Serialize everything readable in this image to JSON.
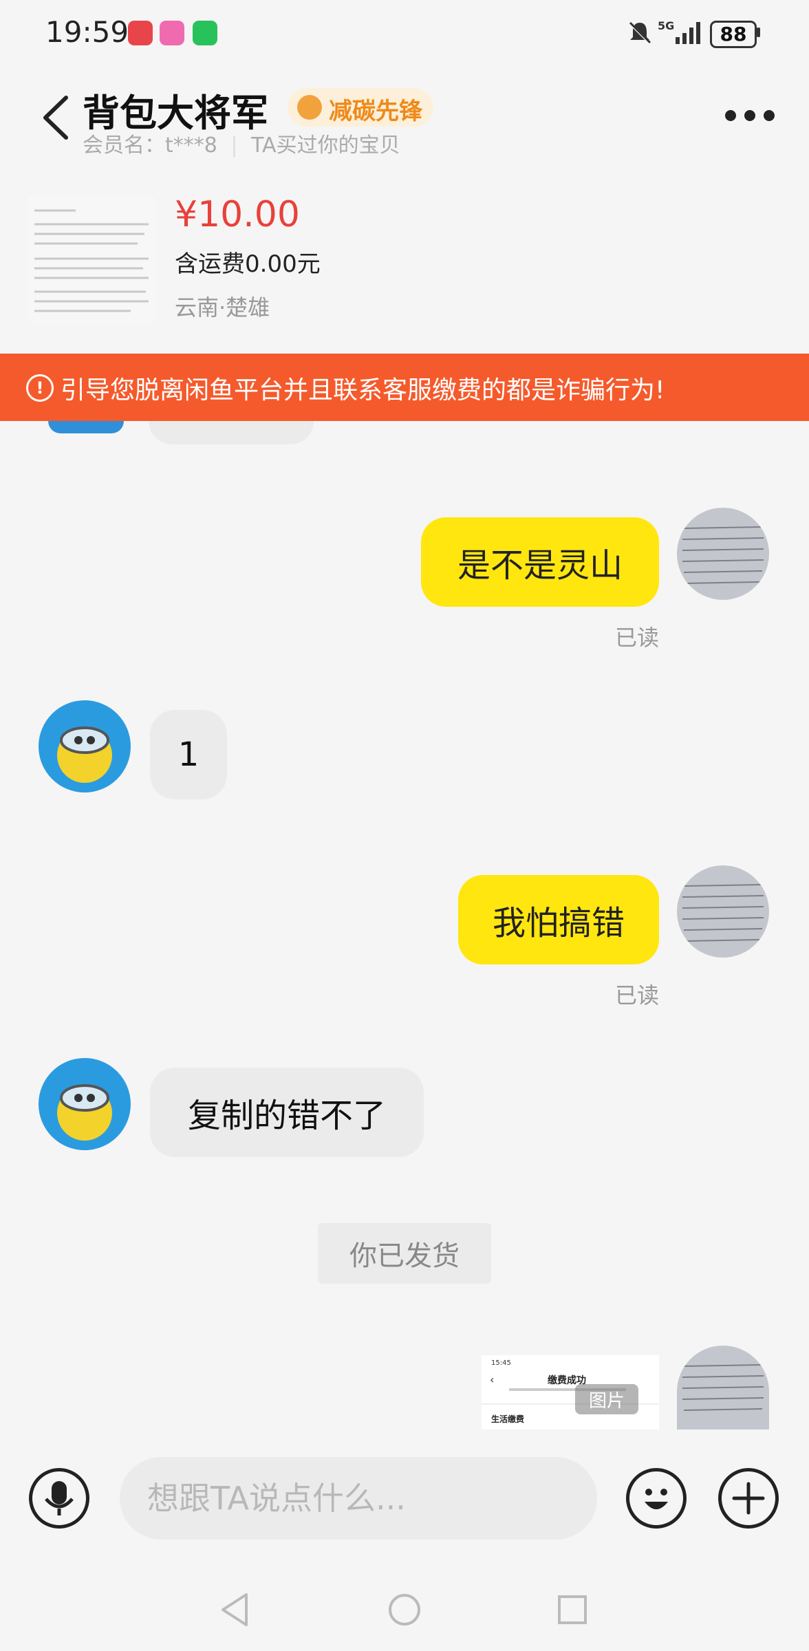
{
  "status_bar": {
    "time": "19:59",
    "battery": "88",
    "network": "5G",
    "icons": [
      "mute-bell-icon",
      "signal-icon",
      "battery-icon"
    ]
  },
  "header": {
    "shop_name": "背包大将军",
    "badge_label": "减碳先锋",
    "member_line": "会员名：t***8",
    "bought_note": "TA买过你的宝贝"
  },
  "product": {
    "price": "¥10.00",
    "shipping": "含运费0.00元",
    "location": "云南·楚雄"
  },
  "warning": {
    "text": "引导您脱离闲鱼平台并且联系客服缴费的都是诈骗行为!"
  },
  "messages": [
    {
      "side": "right",
      "text": "是不是灵山",
      "status": "已读"
    },
    {
      "side": "left",
      "text": "1"
    },
    {
      "side": "right",
      "text": "我怕搞错",
      "status": "已读"
    },
    {
      "side": "left",
      "text": "复制的错不了"
    }
  ],
  "system_notice": "你已发货",
  "image_message": {
    "overlay_label": "图片",
    "preview_title": "缴费成功",
    "preview_line": "生活缴费",
    "preview_time": "15:45"
  },
  "input": {
    "placeholder": "想跟TA说点什么..."
  },
  "colors": {
    "accent_yellow": "#ffe60f",
    "warning_orange": "#f55a2c",
    "price_red": "#e8413a",
    "badge_orange": "#ee8a1a"
  }
}
